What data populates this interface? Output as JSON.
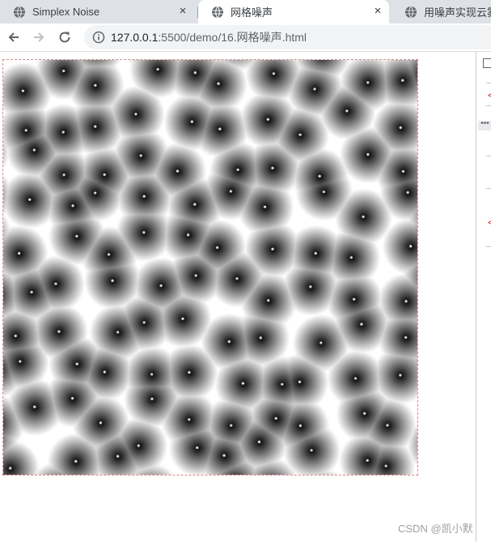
{
  "browser": {
    "tabs": [
      {
        "title": "Simplex Noise",
        "favicon": "globe-icon",
        "close": "×",
        "active": false
      },
      {
        "title": "网格噪声",
        "favicon": "globe-icon",
        "close": "×",
        "active": true
      },
      {
        "title": "用噪声实现云雾效",
        "favicon": "globe-icon",
        "active": false
      }
    ],
    "nav": {
      "back": "back-arrow-icon",
      "forward": "forward-arrow-icon",
      "reload": "reload-icon"
    },
    "address": {
      "host": "127.0.0.1",
      "rest": ":5500/demo/16.网格噪声.html",
      "security_icon": "info-icon"
    }
  },
  "page": {
    "canvas": {
      "type": "cellular-noise",
      "grid_cells": 10,
      "dark_color": "#000000",
      "light_color": "#ffffff",
      "border_color": "#d98a8a"
    }
  },
  "devtools": {
    "red_marks": [
      "<",
      "<",
      "<"
    ],
    "more": "•••"
  },
  "watermark": "CSDN @凯小默",
  "colors": {
    "tabstrip": "#dee1e6",
    "omnibox": "#f1f3f4",
    "active_tab": "#ffffff",
    "icon": "#5f6368"
  }
}
